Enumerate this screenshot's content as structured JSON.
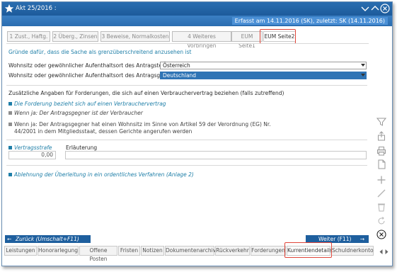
{
  "window": {
    "title": "Akt 25/2016 :",
    "info": "Erfasst am 14.11.2016 (SK), zuletzt: SK (14.11.2016)"
  },
  "tabs": [
    {
      "label": "1 Zust., Haftg.",
      "active": false
    },
    {
      "label": "2 Überg., Zinsen",
      "active": false
    },
    {
      "label": "3 Beweise, Normalkosten",
      "active": false
    },
    {
      "label": "4 Weiteres Vorbringen",
      "active": false
    },
    {
      "label": "EUM Seite1",
      "active": false
    },
    {
      "label": "EUM Seite2",
      "active": true
    }
  ],
  "section1": {
    "heading": "Gründe dafür, dass die Sache als grenzüberschreitend anzusehen ist",
    "row1_label": "Wohnsitz oder gewöhnlicher Aufenthaltsort des Antragstellers",
    "row1_value": "Österreich",
    "row2_label": "Wohnsitz oder gewöhnlicher Aufenthaltsort des Antragsgegners",
    "row2_value": "Deutschland"
  },
  "section2": {
    "heading": "Zusätzliche Angaben für Forderungen, die sich auf einen Verbrauchervertrag beziehen (falls zutreffend)",
    "opt1": "Die Forderung bezieht sich auf einen Verbrauchervertrag",
    "opt2": "Wenn ja: Der Antragsgegner ist der Verbraucher",
    "opt3_line1": "Wenn ja: Der Antragsgegner hat einen Wohnsitz im Sinne von Artikel 59 der Verordnung (EG) Nr.",
    "opt3_line2": "44/2001 in dem Mitgliedsstaat, dessen Gerichte angerufen werden"
  },
  "section3": {
    "penalty_label": "Vertragsstrafe",
    "penalty_value": "0,00",
    "explanation_label": "Erläuterung",
    "explanation_value": ""
  },
  "section4": {
    "opt": "Ablehnung der Überleitung in ein ordentliches Verfahren (Anlage 2)"
  },
  "nav": {
    "back": "Zurück (Umschalt+F11)",
    "next": "Weiter (F11)"
  },
  "bottom_tabs": [
    {
      "label": "Leistungen",
      "active": false
    },
    {
      "label": "Honorarlegung",
      "active": false
    },
    {
      "label": "Offene Posten",
      "active": false
    },
    {
      "label": "Fristen",
      "active": false
    },
    {
      "label": "Notizen",
      "active": false
    },
    {
      "label": "Dokumentenarchiv",
      "active": false
    },
    {
      "label": "Rückverkehr",
      "active": false
    },
    {
      "label": "Forderungen",
      "active": false
    },
    {
      "label": "Kurrentiendetails",
      "active": true
    },
    {
      "label": "Schuldnerkonto",
      "active": false
    }
  ],
  "sidebar_icons": [
    "filter-icon",
    "share-icon",
    "print-icon",
    "document-icon",
    "add-icon",
    "edit-icon",
    "delete-icon",
    "refresh-icon",
    "close-icon"
  ],
  "colors": {
    "titlebar": "#1d5b9b",
    "accent": "#1f7fa8",
    "highlight": "#e0463a",
    "selected": "#2f74b5"
  }
}
